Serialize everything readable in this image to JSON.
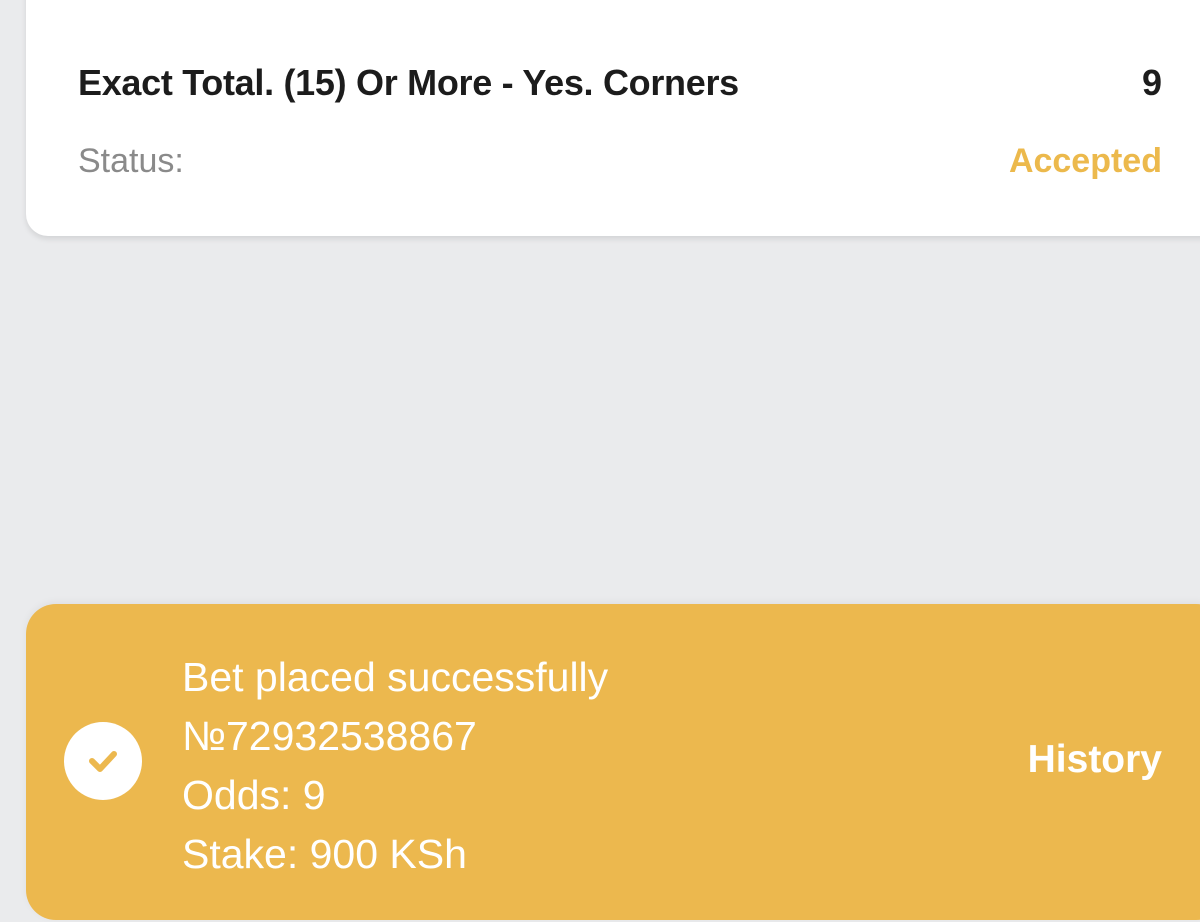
{
  "bet_card": {
    "market": "Exact Total. (15) Or More - Yes. Corners",
    "odds": "9",
    "status_label": "Status:",
    "status_value": "Accepted"
  },
  "toast": {
    "title": "Bet placed successfully",
    "bet_number": "№72932538867",
    "odds_line": "Odds: 9",
    "stake_line": "Stake: 900 KSh",
    "history_label": "History",
    "icon": "check-circle-icon"
  },
  "colors": {
    "background": "#eaebed",
    "card": "#ffffff",
    "accent": "#ecb84e",
    "status_accepted": "#ecb94c",
    "text_dark": "#1c1c1c",
    "text_muted": "#8a8a8a"
  }
}
